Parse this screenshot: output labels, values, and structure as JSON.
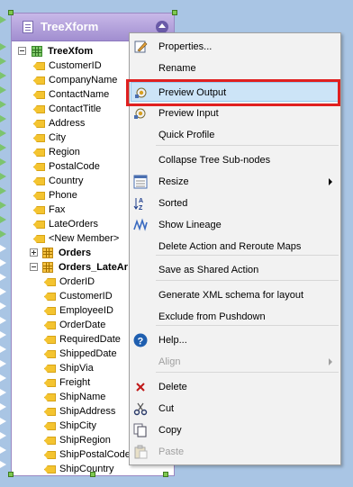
{
  "node": {
    "title": "TreeXform",
    "root_label": "TreeXfom",
    "fields": [
      "CustomerID",
      "CompanyName",
      "ContactName",
      "ContactTitle",
      "Address",
      "City",
      "Region",
      "PostalCode",
      "Country",
      "Phone",
      "Fax",
      "LateOrders",
      "<New Member>"
    ],
    "group_orders": "Orders",
    "group_late": "Orders_LateAr",
    "late_fields": [
      "OrderID",
      "CustomerID",
      "EmployeeID",
      "OrderDate",
      "RequiredDate",
      "ShippedDate",
      "ShipVia",
      "Freight",
      "ShipName",
      "ShipAddress",
      "ShipCity",
      "ShipRegion",
      "ShipPostalCode",
      "ShipCountry"
    ]
  },
  "menu": {
    "items": [
      {
        "label": "Properties...",
        "icon": "properties-icon"
      },
      {
        "label": "Rename",
        "icon": ""
      },
      {
        "label": "Preview Output",
        "icon": "preview-output-icon",
        "highlighted": true
      },
      {
        "label": "Preview Input",
        "icon": "preview-input-icon"
      },
      {
        "label": "Quick Profile",
        "icon": ""
      },
      {
        "label": "Collapse Tree Sub-nodes",
        "icon": ""
      },
      {
        "label": "Resize",
        "icon": "resize-icon",
        "submenu": true
      },
      {
        "label": "Sorted",
        "icon": "sort-az-icon"
      },
      {
        "label": "Show Lineage",
        "icon": "lineage-icon"
      },
      {
        "label": "Delete Action and Reroute Maps",
        "icon": ""
      },
      {
        "label": "Save as Shared Action",
        "icon": ""
      },
      {
        "label": "Generate XML schema for layout",
        "icon": ""
      },
      {
        "label": "Exclude from Pushdown",
        "icon": ""
      },
      {
        "label": "Help...",
        "icon": "help-icon"
      },
      {
        "label": "Align",
        "icon": "",
        "disabled": true,
        "submenu": true
      },
      {
        "label": "Delete",
        "icon": "delete-icon"
      },
      {
        "label": "Cut",
        "icon": "cut-icon"
      },
      {
        "label": "Copy",
        "icon": "copy-icon"
      },
      {
        "label": "Paste",
        "icon": "paste-icon",
        "disabled": true
      }
    ]
  },
  "colors": {
    "highlight_box": "#e02020",
    "menu_highlight": "#cce4f7",
    "node_header": "#a18ed0",
    "canvas": "#a9c5e4"
  }
}
